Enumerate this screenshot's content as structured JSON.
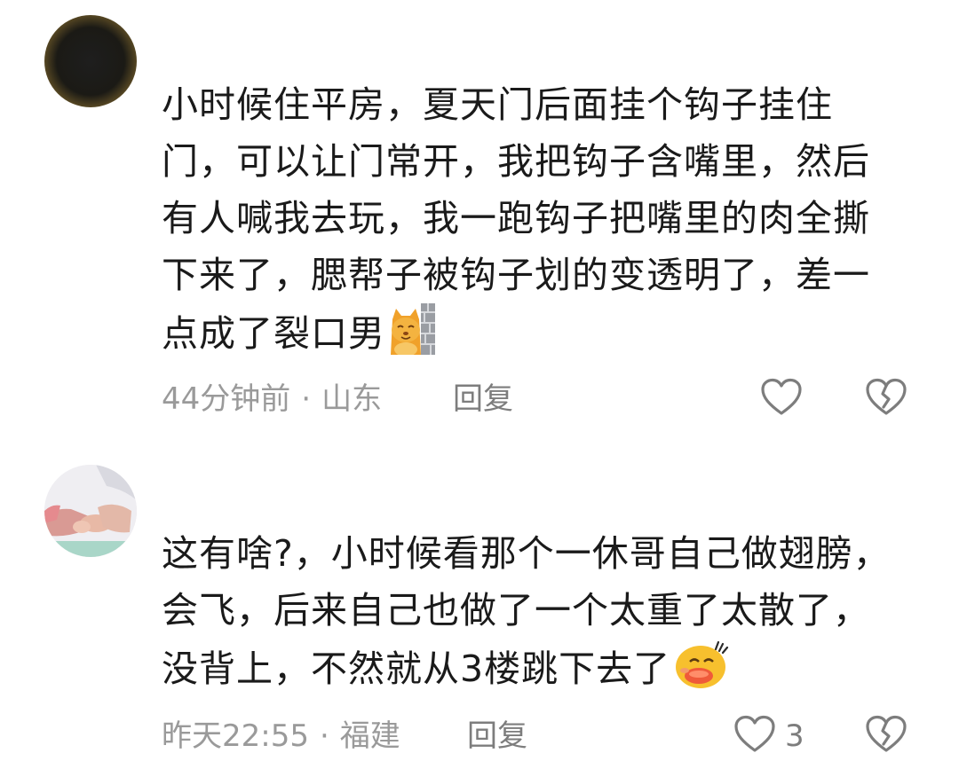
{
  "comments": [
    {
      "text": "小时候住平房，夏天门后面挂个钩子挂住门，可以让门常开，我把钩子含嘴里，然后有人喊我去玩，我一跑钩子把嘴里的肉全撕下来了，腮帮子被钩子划的变透明了，差一点成了裂口男",
      "emoji": "cat-peeking-from-wall",
      "time": "44分钟前",
      "separator": "·",
      "location": "山东",
      "reply_label": "回复",
      "likes": ""
    },
    {
      "text": "这有啥?，小时候看那个一休哥自己做翅膀，会飞，后来自己也做了一个太重了太散了，没背上，不然就从3楼跳下去了",
      "emoji": "sweating-smile-face",
      "time": "昨天22:55",
      "separator": "·",
      "location": "福建",
      "reply_label": "回复",
      "likes": "3"
    }
  ],
  "icons": {
    "like": "heart-outline-icon",
    "dislike": "broken-heart-icon"
  },
  "colors": {
    "text": "#1a1a1a",
    "meta": "#9a9a9a",
    "icon": "#7d7d7d"
  }
}
